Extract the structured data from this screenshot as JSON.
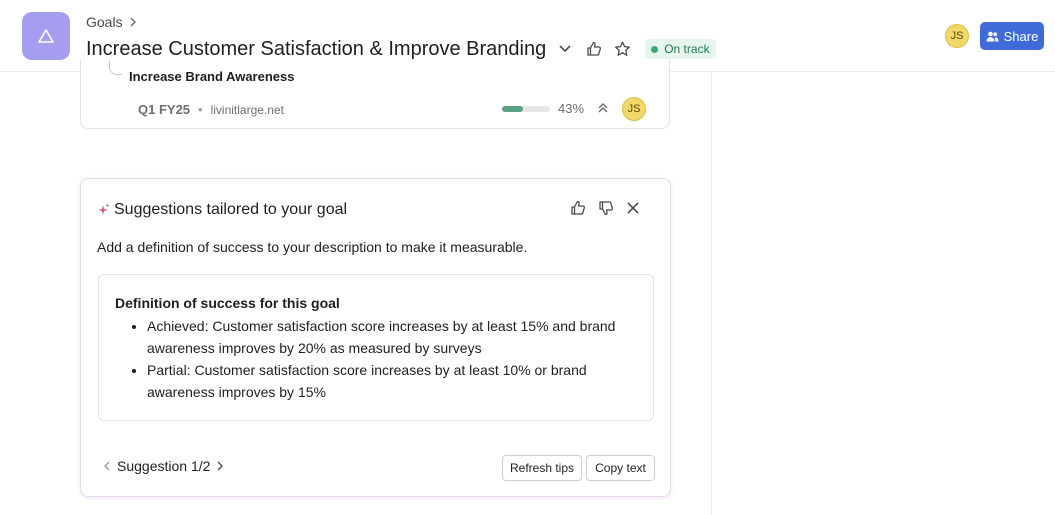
{
  "header": {
    "breadcrumb": "Goals",
    "title": "Increase Customer Satisfaction & Improve Branding",
    "status": "On track",
    "user_initials": "JS",
    "share_label": "Share"
  },
  "subgoal": {
    "title": "Increase Brand Awareness",
    "period": "Q1 FY25",
    "separator": "•",
    "domain": "livinitlarge.net",
    "progress_percent": 43,
    "progress_label": "43%",
    "owner_initials": "JS"
  },
  "suggestions": {
    "title": "Suggestions tailored to your goal",
    "description": "Add a definition of success to your description to make it measurable.",
    "definition_title": "Definition of success for this goal",
    "items": [
      "Achieved: Customer satisfaction score increases by at least 15% and brand awareness improves by 20% as measured by surveys",
      "Partial: Customer satisfaction score increases by at least 10% or brand awareness improves by 15%"
    ],
    "pager_label": "Suggestion 1/2",
    "refresh_label": "Refresh tips",
    "copy_label": "Copy text"
  },
  "colors": {
    "app_icon": "#a49df0",
    "status_bg": "#e6f6ef",
    "status_text": "#1f7a4f",
    "share_button": "#3f6ad8",
    "progress_fill": "#58a182",
    "avatar": "#f2d86a"
  },
  "icons": [
    "goal-triangle-icon",
    "chevron-right-icon",
    "chevron-down-icon",
    "thumbs-up-icon",
    "star-icon",
    "people-icon",
    "double-chevron-up-icon",
    "sparkle-icon",
    "thumbs-down-icon",
    "close-icon",
    "chevron-left-icon"
  ]
}
